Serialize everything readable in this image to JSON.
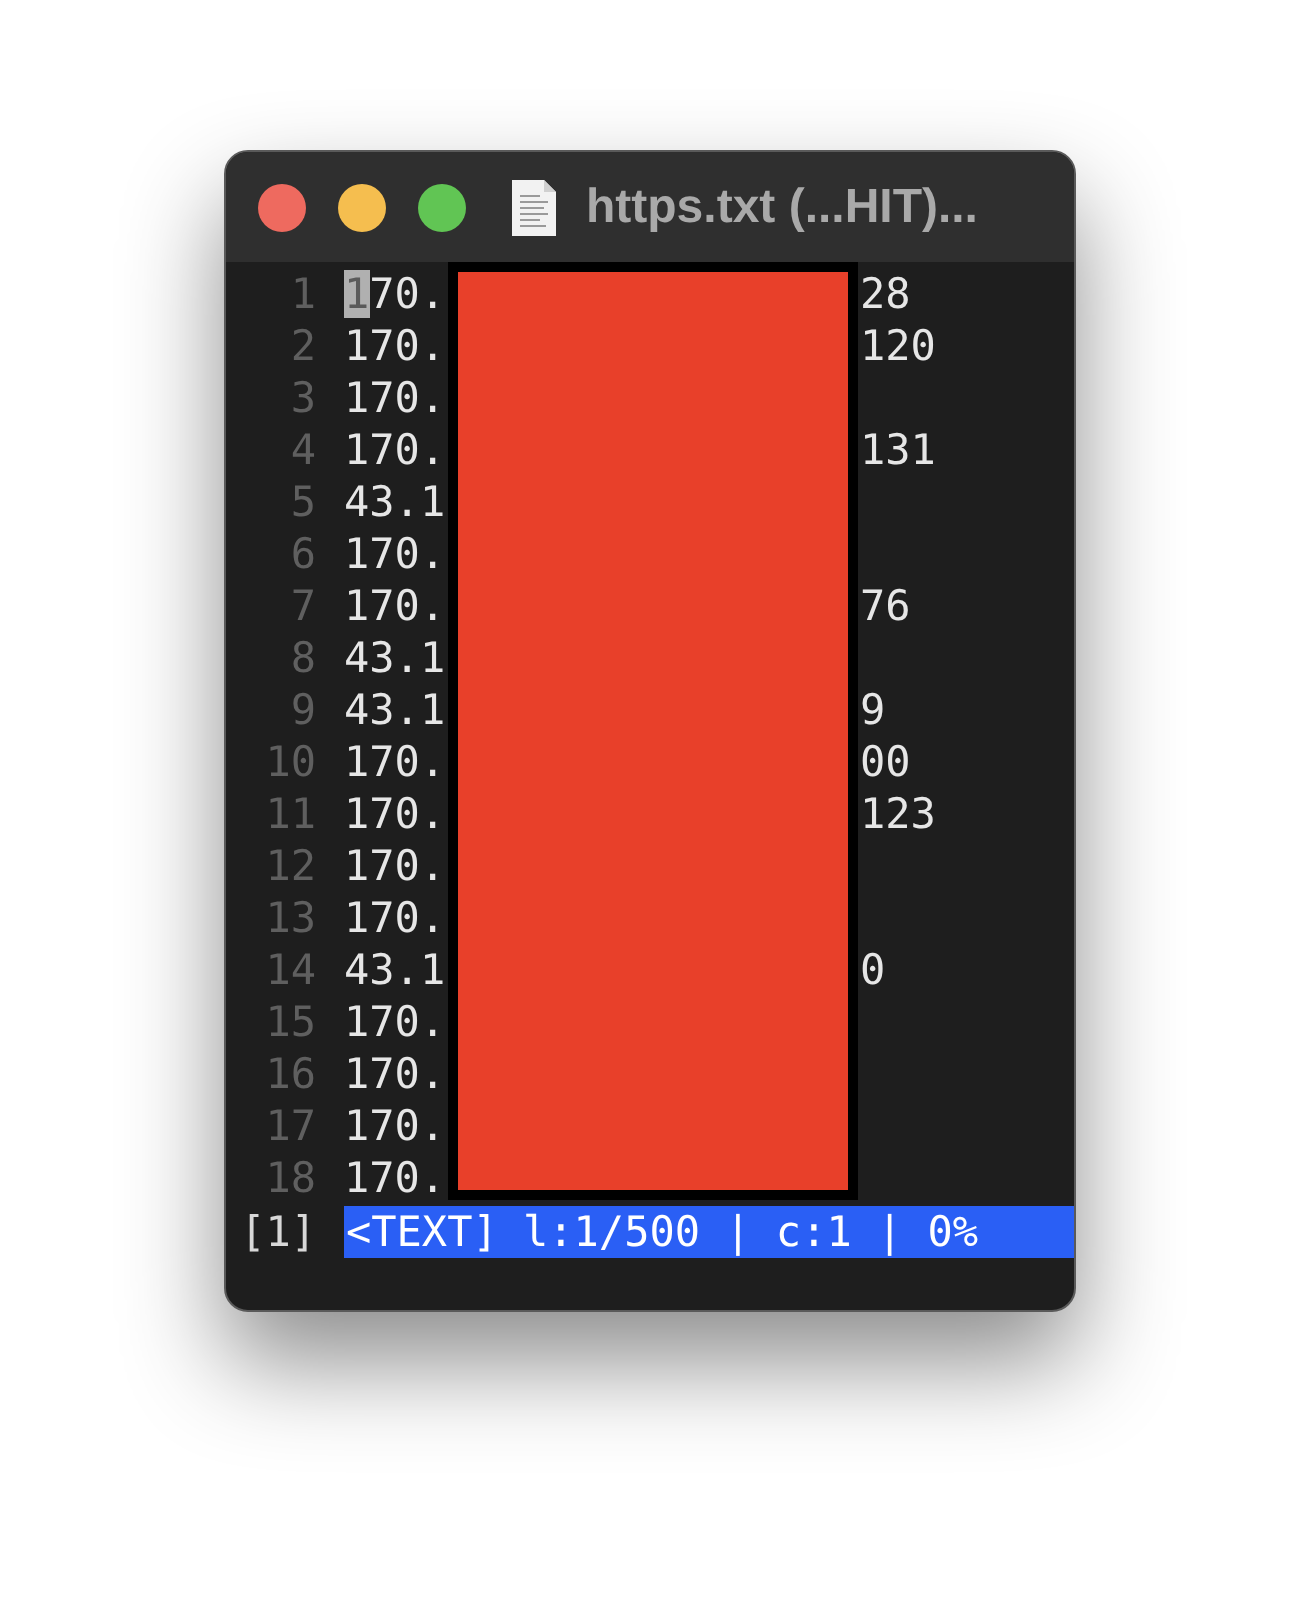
{
  "window": {
    "title": "https.txt (...HIT)..."
  },
  "lines": [
    {
      "number": "1",
      "start": "170.",
      "end": "28",
      "cursor": true
    },
    {
      "number": "2",
      "start": "170.",
      "end": "120",
      "cursor": false
    },
    {
      "number": "3",
      "start": "170.",
      "cursor": false
    },
    {
      "number": "4",
      "start": "170.",
      "end": "131",
      "cursor": false
    },
    {
      "number": "5",
      "start": "43.1",
      "cursor": false
    },
    {
      "number": "6",
      "start": "170.",
      "cursor": false
    },
    {
      "number": "7",
      "start": "170.",
      "end": "76",
      "cursor": false
    },
    {
      "number": "8",
      "start": "43.1",
      "cursor": false
    },
    {
      "number": "9",
      "start": "43.1",
      "end": "9",
      "cursor": false
    },
    {
      "number": "10",
      "start": "170.",
      "end": "00",
      "cursor": false
    },
    {
      "number": "11",
      "start": "170.",
      "end": "123",
      "cursor": false
    },
    {
      "number": "12",
      "start": "170.",
      "cursor": false
    },
    {
      "number": "13",
      "start": "170.",
      "cursor": false
    },
    {
      "number": "14",
      "start": "43.1",
      "end": "0",
      "cursor": false
    },
    {
      "number": "15",
      "start": "170.",
      "cursor": false
    },
    {
      "number": "16",
      "start": "170.",
      "cursor": false
    },
    {
      "number": "17",
      "start": "170.",
      "cursor": false
    },
    {
      "number": "18",
      "start": "170.",
      "cursor": false
    }
  ],
  "status_bar": {
    "buffer": "[1]",
    "info": "<TEXT] l:1/500 | c:1 | 0%"
  }
}
